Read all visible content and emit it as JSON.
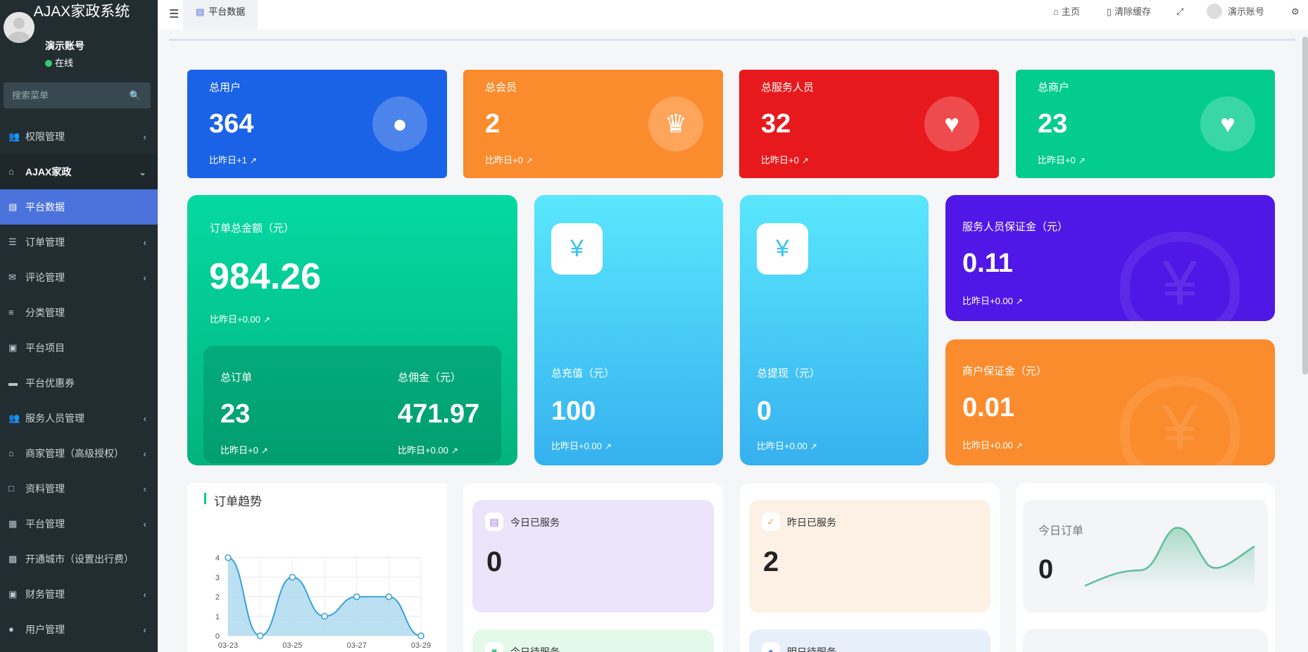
{
  "app": {
    "title": "AJAX家政系统",
    "user_name": "演示账号",
    "status": "在线",
    "search_placeholder": "搜索菜单"
  },
  "menu": [
    {
      "label": "权限管理",
      "icon": "users-icon"
    },
    {
      "label": "AJAX家政",
      "icon": "home-icon"
    },
    {
      "label": "平台数据",
      "icon": "bar-chart-icon"
    },
    {
      "label": "订单管理",
      "icon": "list-icon"
    },
    {
      "label": "评论管理",
      "icon": "comments-icon"
    },
    {
      "label": "分类管理",
      "icon": "sliders-icon"
    },
    {
      "label": "平台项目",
      "icon": "briefcase-icon"
    },
    {
      "label": "平台优惠券",
      "icon": "credit-card-icon"
    },
    {
      "label": "服务人员管理",
      "icon": "users-icon"
    },
    {
      "label": "商家管理（高级授权）",
      "icon": "bank-icon"
    },
    {
      "label": "资料管理",
      "icon": "folder-icon"
    },
    {
      "label": "平台管理",
      "icon": "grid-icon"
    },
    {
      "label": "开通城市（设置出行费）",
      "icon": "car-icon"
    },
    {
      "label": "财务管理",
      "icon": "archive-icon"
    },
    {
      "label": "用户管理",
      "icon": "user-circle-icon"
    }
  ],
  "topbar": {
    "tab": "平台数据",
    "home": "主页",
    "clear_cache": "清除缓存",
    "account": "演示账号"
  },
  "stats": [
    {
      "title": "总用户",
      "value": "364",
      "change": "比昨日+1",
      "color": "#1a62e6",
      "icon": "user-icon"
    },
    {
      "title": "总会员",
      "value": "2",
      "change": "比昨日+0",
      "color": "#fb8c2e",
      "icon": "crown-icon"
    },
    {
      "title": "总服务人员",
      "value": "32",
      "change": "比昨日+0",
      "color": "#e8191c",
      "icon": "trophy-heart-icon"
    },
    {
      "title": "总商户",
      "value": "23",
      "change": "比昨日+0",
      "color": "#03cc8e",
      "icon": "trophy-heart-icon"
    }
  ],
  "order_total": {
    "title": "订单总金额（元）",
    "value": "984.26",
    "change": "比昨日+0.00",
    "orders_label": "总订单",
    "orders_value": "23",
    "orders_change": "比昨日+0",
    "commission_label": "总佣金（元）",
    "commission_value": "471.97",
    "commission_change": "比昨日+0.00"
  },
  "recharge": {
    "title": "总充值（元）",
    "value": "100",
    "change": "比昨日+0.00"
  },
  "withdraw": {
    "title": "总提现（元）",
    "value": "0",
    "change": "比昨日+0.00"
  },
  "staff_deposit": {
    "title": "服务人员保证金（元）",
    "value": "0.11",
    "change": "比昨日+0.00"
  },
  "merchant_deposit": {
    "title": "商户保证金（元）",
    "value": "0.01",
    "change": "比昨日+0.00"
  },
  "trend": {
    "title": "订单趋势"
  },
  "today_served": {
    "title": "今日已服务",
    "value": "0"
  },
  "yesterday_served": {
    "title": "昨日已服务",
    "value": "2"
  },
  "today_pending": {
    "title": "今日待服务"
  },
  "tomorrow_pending": {
    "title": "明日待服务"
  },
  "today_orders": {
    "title": "今日订单",
    "value": "0"
  },
  "chart_data": {
    "type": "area",
    "x": [
      "03-23",
      "03-24",
      "03-25",
      "03-26",
      "03-27",
      "03-28",
      "03-29"
    ],
    "values": [
      4,
      0,
      3,
      1,
      2,
      2,
      0
    ],
    "xticks": [
      "03-23",
      "03-25",
      "03-27",
      "03-29"
    ],
    "yticks": [
      "0",
      "1",
      "2",
      "3",
      "4"
    ],
    "ylim": [
      0,
      4
    ],
    "color": "#3aa0d8"
  }
}
